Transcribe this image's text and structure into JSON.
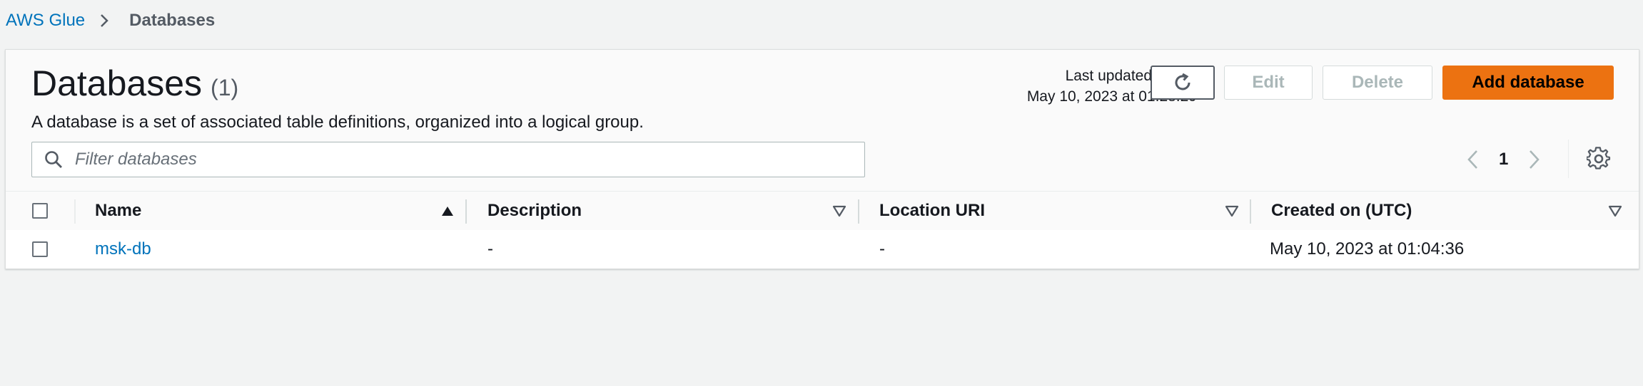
{
  "breadcrumb": {
    "service": "AWS Glue",
    "current": "Databases"
  },
  "header": {
    "title": "Databases",
    "count": "(1)",
    "description": "A database is a set of associated table definitions, organized into a logical group.",
    "last_updated_label": "Last updated (UTC)",
    "last_updated_value": "May 10, 2023 at 01:28:29"
  },
  "actions": {
    "edit": "Edit",
    "delete": "Delete",
    "add": "Add database"
  },
  "filter": {
    "placeholder": "Filter databases",
    "value": ""
  },
  "pagination": {
    "current_page": "1"
  },
  "table": {
    "columns": [
      "Name",
      "Description",
      "Location URI",
      "Created on (UTC)"
    ],
    "rows": [
      {
        "name": "msk-db",
        "description": "-",
        "location_uri": "-",
        "created_on": "May 10, 2023 at 01:04:36"
      }
    ]
  },
  "colors": {
    "link": "#0073bb",
    "primary": "#ec7211",
    "background": "#f2f3f3"
  },
  "icons": [
    "chevron-right-icon",
    "refresh-icon",
    "search-icon",
    "chevron-left-icon",
    "settings-icon",
    "sort-ascending-icon",
    "sort-descending-icon"
  ]
}
